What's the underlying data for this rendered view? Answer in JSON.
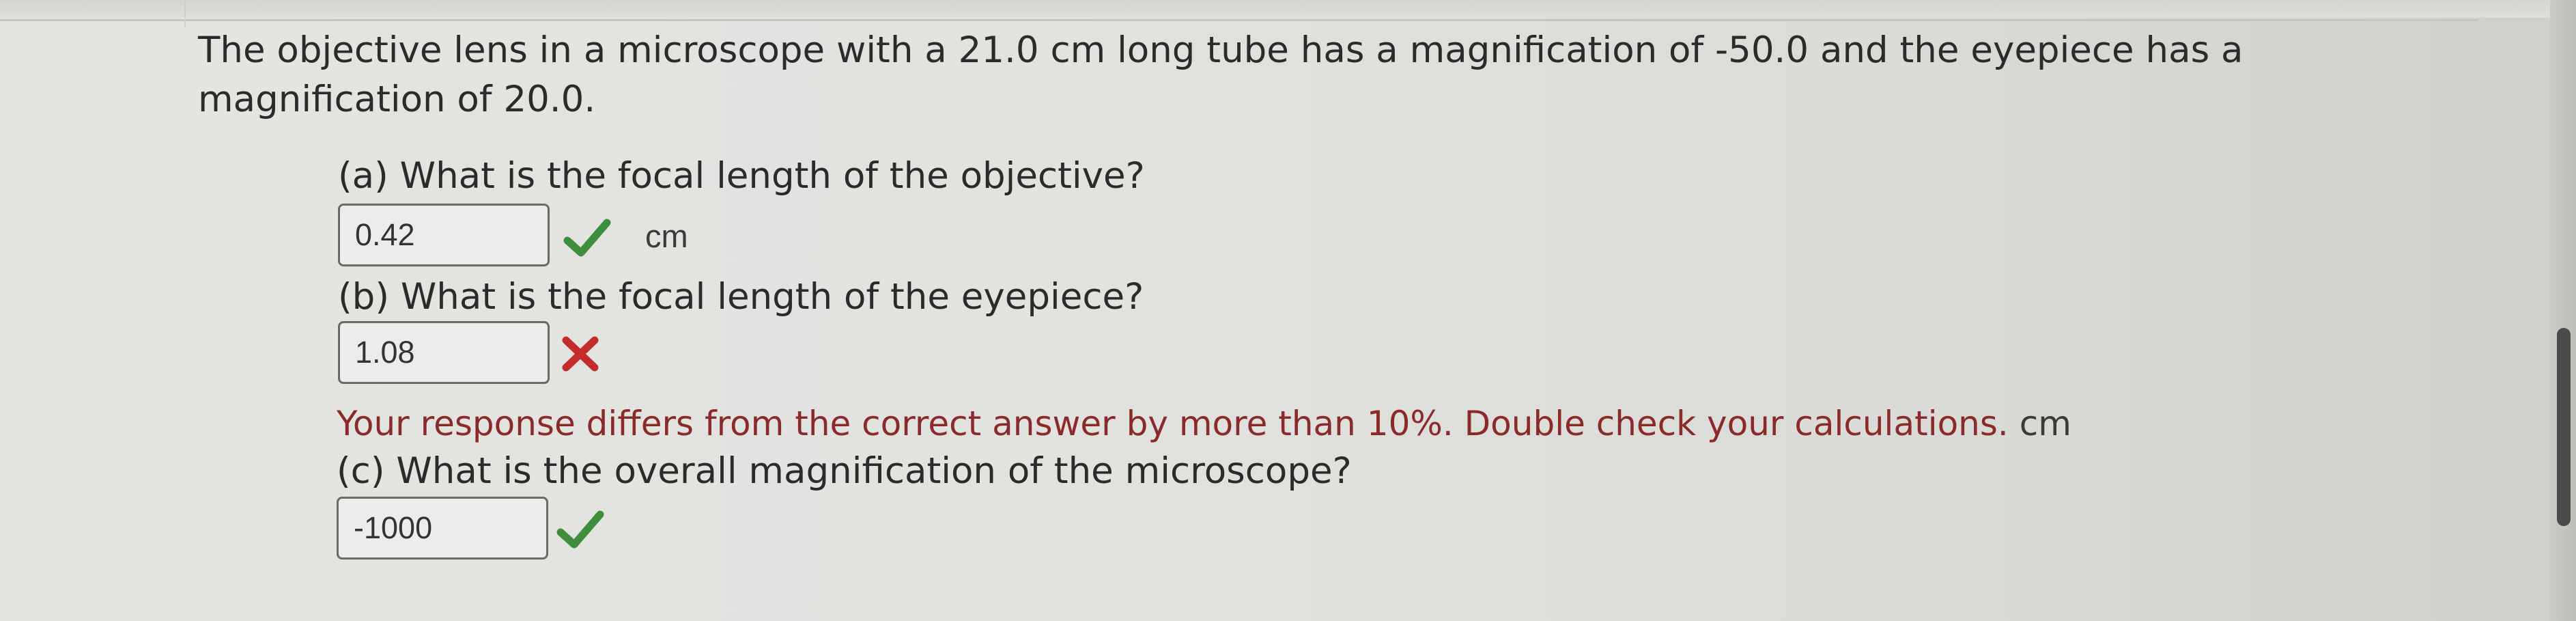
{
  "question": {
    "text": "The objective lens in a microscope with a 21.0 cm long tube has a magnification of -50.0 and the eyepiece has a magnification of 20.0."
  },
  "parts": [
    {
      "label": "(a) What is the focal length of the objective?",
      "answer": "0.42",
      "status": "correct",
      "unit": "cm"
    },
    {
      "label": "(b) What is the focal length of the eyepiece?",
      "answer": "1.08",
      "status": "incorrect",
      "feedback": "Your response differs from the correct answer by more than 10%. Double check your calculations.",
      "unit": "cm"
    },
    {
      "label": "(c) What is the overall magnification of the microscope?",
      "answer": "-1000",
      "status": "correct",
      "unit": ""
    }
  ],
  "colors": {
    "correct": "#3e8e3e",
    "incorrect": "#c42b2b",
    "feedback_text": "#8b2a2a"
  },
  "icons": {
    "correct": "check-icon",
    "incorrect": "x-icon"
  }
}
